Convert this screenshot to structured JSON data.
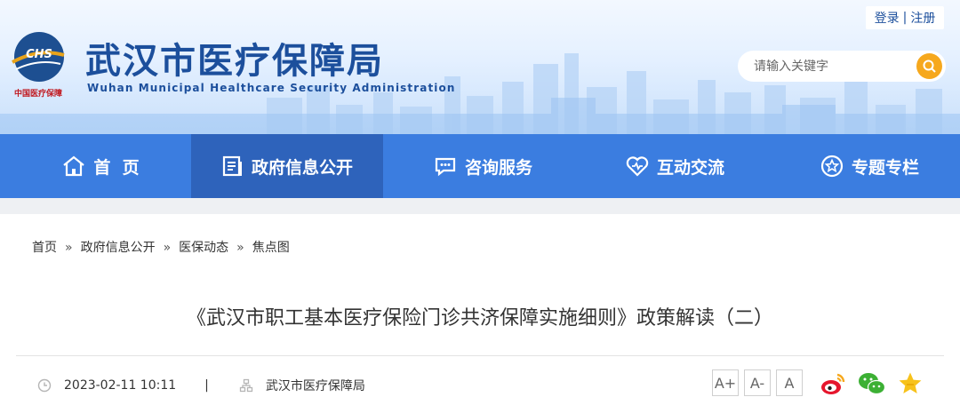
{
  "header": {
    "logo_text": "中国医疗保障",
    "logo_mark": "CHS",
    "title": "武汉市医疗保障局",
    "subtitle": "Wuhan Municipal Healthcare Security Administration",
    "login": "登录",
    "login_sep": "|",
    "register": "注册",
    "search_placeholder": "请输入关键字",
    "search_icon": "search-icon"
  },
  "nav": {
    "items": [
      {
        "label": "首  页",
        "icon": "home-icon"
      },
      {
        "label": "政府信息公开",
        "icon": "document-icon",
        "active": true
      },
      {
        "label": "咨询服务",
        "icon": "chat-icon"
      },
      {
        "label": "互动交流",
        "icon": "heart-icon"
      },
      {
        "label": "专题专栏",
        "icon": "star-icon"
      }
    ]
  },
  "breadcrumb": {
    "items": [
      "首页",
      "政府信息公开",
      "医保动态",
      "焦点图"
    ],
    "separator": "»"
  },
  "article": {
    "title": "《武汉市职工基本医疗保险门诊共济保障实施细则》政策解读（二）",
    "date": "2023-02-11 10:11",
    "meta_sep": "|",
    "source": "武汉市医疗保障局",
    "font_controls": [
      "A+",
      "A-",
      "A"
    ],
    "share": [
      "weibo-icon",
      "wechat-icon",
      "favorite-icon"
    ]
  },
  "colors": {
    "brand": "#1c4f9c",
    "nav": "#3b7de0",
    "nav_active": "#2e63bb",
    "search_button": "#f6a81d",
    "logo_red": "#c0181f"
  }
}
